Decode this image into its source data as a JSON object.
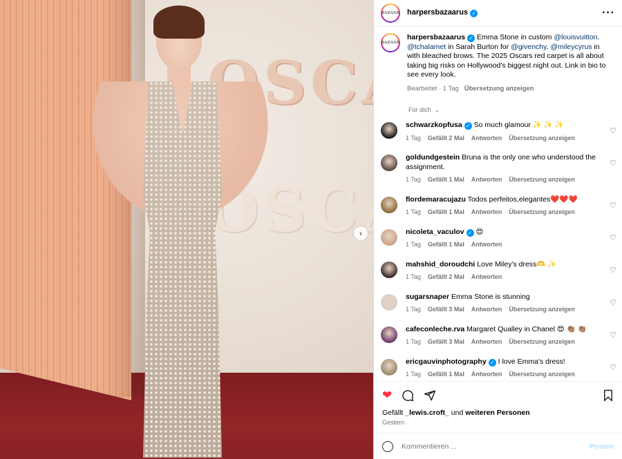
{
  "header": {
    "username": "harpersbazaarus",
    "avatar_text": "BAZAAR"
  },
  "caption": {
    "username": "harpersbazaarus",
    "text_1": " Emma Stone in custom ",
    "mention_1": "@louisvuitton",
    "text_2": ". ",
    "mention_2": "@tchalamet",
    "text_3": " in Sarah Burton for ",
    "mention_3": "@givenchy",
    "text_4": ". ",
    "mention_4": "@mileycyrus",
    "text_5": " in with bleached brows. The 2025 Oscars red carpet is all about taking big risks on Hollywood's biggest night out. Link in bio to see every look.",
    "edited": "Bearbeitet",
    "time": "1 Tag",
    "translate": "Übersetzung anzeigen"
  },
  "filter_label": "Für dich",
  "photo": {
    "letters_top": "OSCARS",
    "letters_bottom": "OSCARS"
  },
  "comments": [
    {
      "username": "schwarzkopfusa",
      "verified": true,
      "text": "So much glamour ✨ ✨ ✨",
      "time": "1 Tag",
      "likes": "Gefällt 2 Mal",
      "reply": "Antworten",
      "translate": "Übersetzung anzeigen",
      "avatar_color": "#1a1a1a"
    },
    {
      "username": "goldundgestein",
      "verified": false,
      "text": "Bruna is the only one who understood the assignment.",
      "time": "1 Tag",
      "likes": "Gefällt 1 Mal",
      "reply": "Antworten",
      "translate": "Übersetzung anzeigen",
      "avatar_color": "#5b4a44"
    },
    {
      "username": "flordemaracujazu",
      "verified": false,
      "text": "Todos perfeitos,elegantes❤️❤️❤️",
      "time": "1 Tag",
      "likes": "Gefällt 1 Mal",
      "reply": "Antworten",
      "translate": "Übersetzung anzeigen",
      "avatar_color": "#8a6a3a"
    },
    {
      "username": "nicoleta_vaculov",
      "verified": true,
      "text": "😍",
      "time": "1 Tag",
      "likes": "Gefällt 1 Mal",
      "reply": "Antworten",
      "translate": "",
      "avatar_color": "#c9a48a"
    },
    {
      "username": "mahshid_doroudchi",
      "verified": false,
      "text": "Love Miley's dress🫶 ✨",
      "time": "1 Tag",
      "likes": "Gefällt 2 Mal",
      "reply": "Antworten",
      "translate": "",
      "avatar_color": "#3a2a28"
    },
    {
      "username": "sugarsnaper",
      "verified": false,
      "text": "Emma Stone is stunning",
      "time": "1 Tag",
      "likes": "Gefällt 3 Mal",
      "reply": "Antworten",
      "translate": "Übersetzung anzeigen",
      "avatar_color": "#d8d0c8"
    },
    {
      "username": "cafeconleche.rva",
      "verified": false,
      "text": "Margaret Qualley in Chanel 😍 👏🏽 👏🏽",
      "time": "1 Tag",
      "likes": "Gefällt 3 Mal",
      "reply": "Antworten",
      "translate": "Übersetzung anzeigen",
      "avatar_color": "#6a3a6a"
    },
    {
      "username": "ericgauvinphotography",
      "verified": true,
      "text": "I love Emma's dress!",
      "time": "1 Tag",
      "likes": "Gefällt 1 Mal",
      "reply": "Antworten",
      "translate": "Übersetzung anzeigen",
      "avatar_color": "#9a8a6a"
    }
  ],
  "likes_line": {
    "prefix": "Gefällt ",
    "user": "_lewis.croft_",
    "mid": " und ",
    "others": "weiteren Personen"
  },
  "posted_date": "Gestern",
  "composer": {
    "placeholder": "Kommentieren ...",
    "post_label": "Posten"
  },
  "colors": {
    "like_red": "#ff3040",
    "link_blue": "#00376b",
    "verified_blue": "#0095f6"
  }
}
